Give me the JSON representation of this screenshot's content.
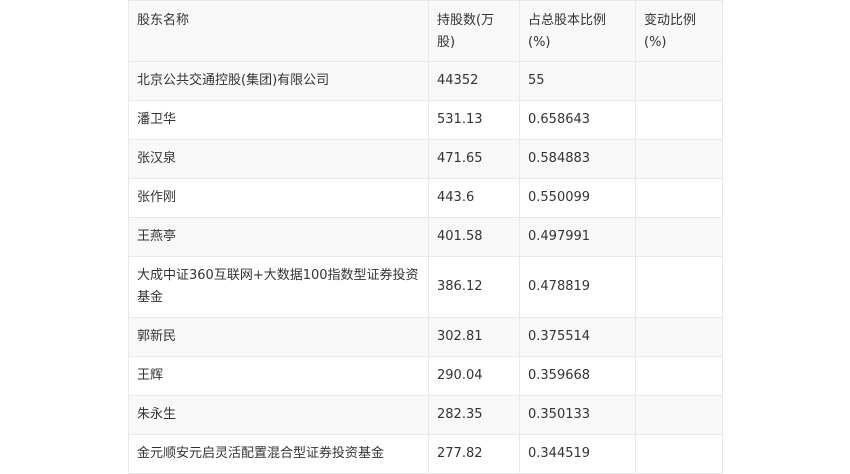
{
  "table": {
    "headers": [
      "股东名称",
      "持股数(万股)",
      "占总股本比例(%)",
      "变动比例(%)"
    ],
    "rows": [
      [
        "北京公共交通控股(集团)有限公司",
        "44352",
        "55",
        ""
      ],
      [
        "潘卫华",
        "531.13",
        "0.658643",
        ""
      ],
      [
        "张汉泉",
        "471.65",
        "0.584883",
        ""
      ],
      [
        "张作刚",
        "443.6",
        "0.550099",
        ""
      ],
      [
        "王燕亭",
        "401.58",
        "0.497991",
        ""
      ],
      [
        "大成中证360互联网+大数据100指数型证券投资基金",
        "386.12",
        "0.478819",
        ""
      ],
      [
        "郭新民",
        "302.81",
        "0.375514",
        ""
      ],
      [
        "王辉",
        "290.04",
        "0.359668",
        ""
      ],
      [
        "朱永生",
        "282.35",
        "0.350133",
        ""
      ],
      [
        "金元顺安元启灵活配置混合型证券投资基金",
        "277.82",
        "0.344519",
        ""
      ]
    ]
  }
}
